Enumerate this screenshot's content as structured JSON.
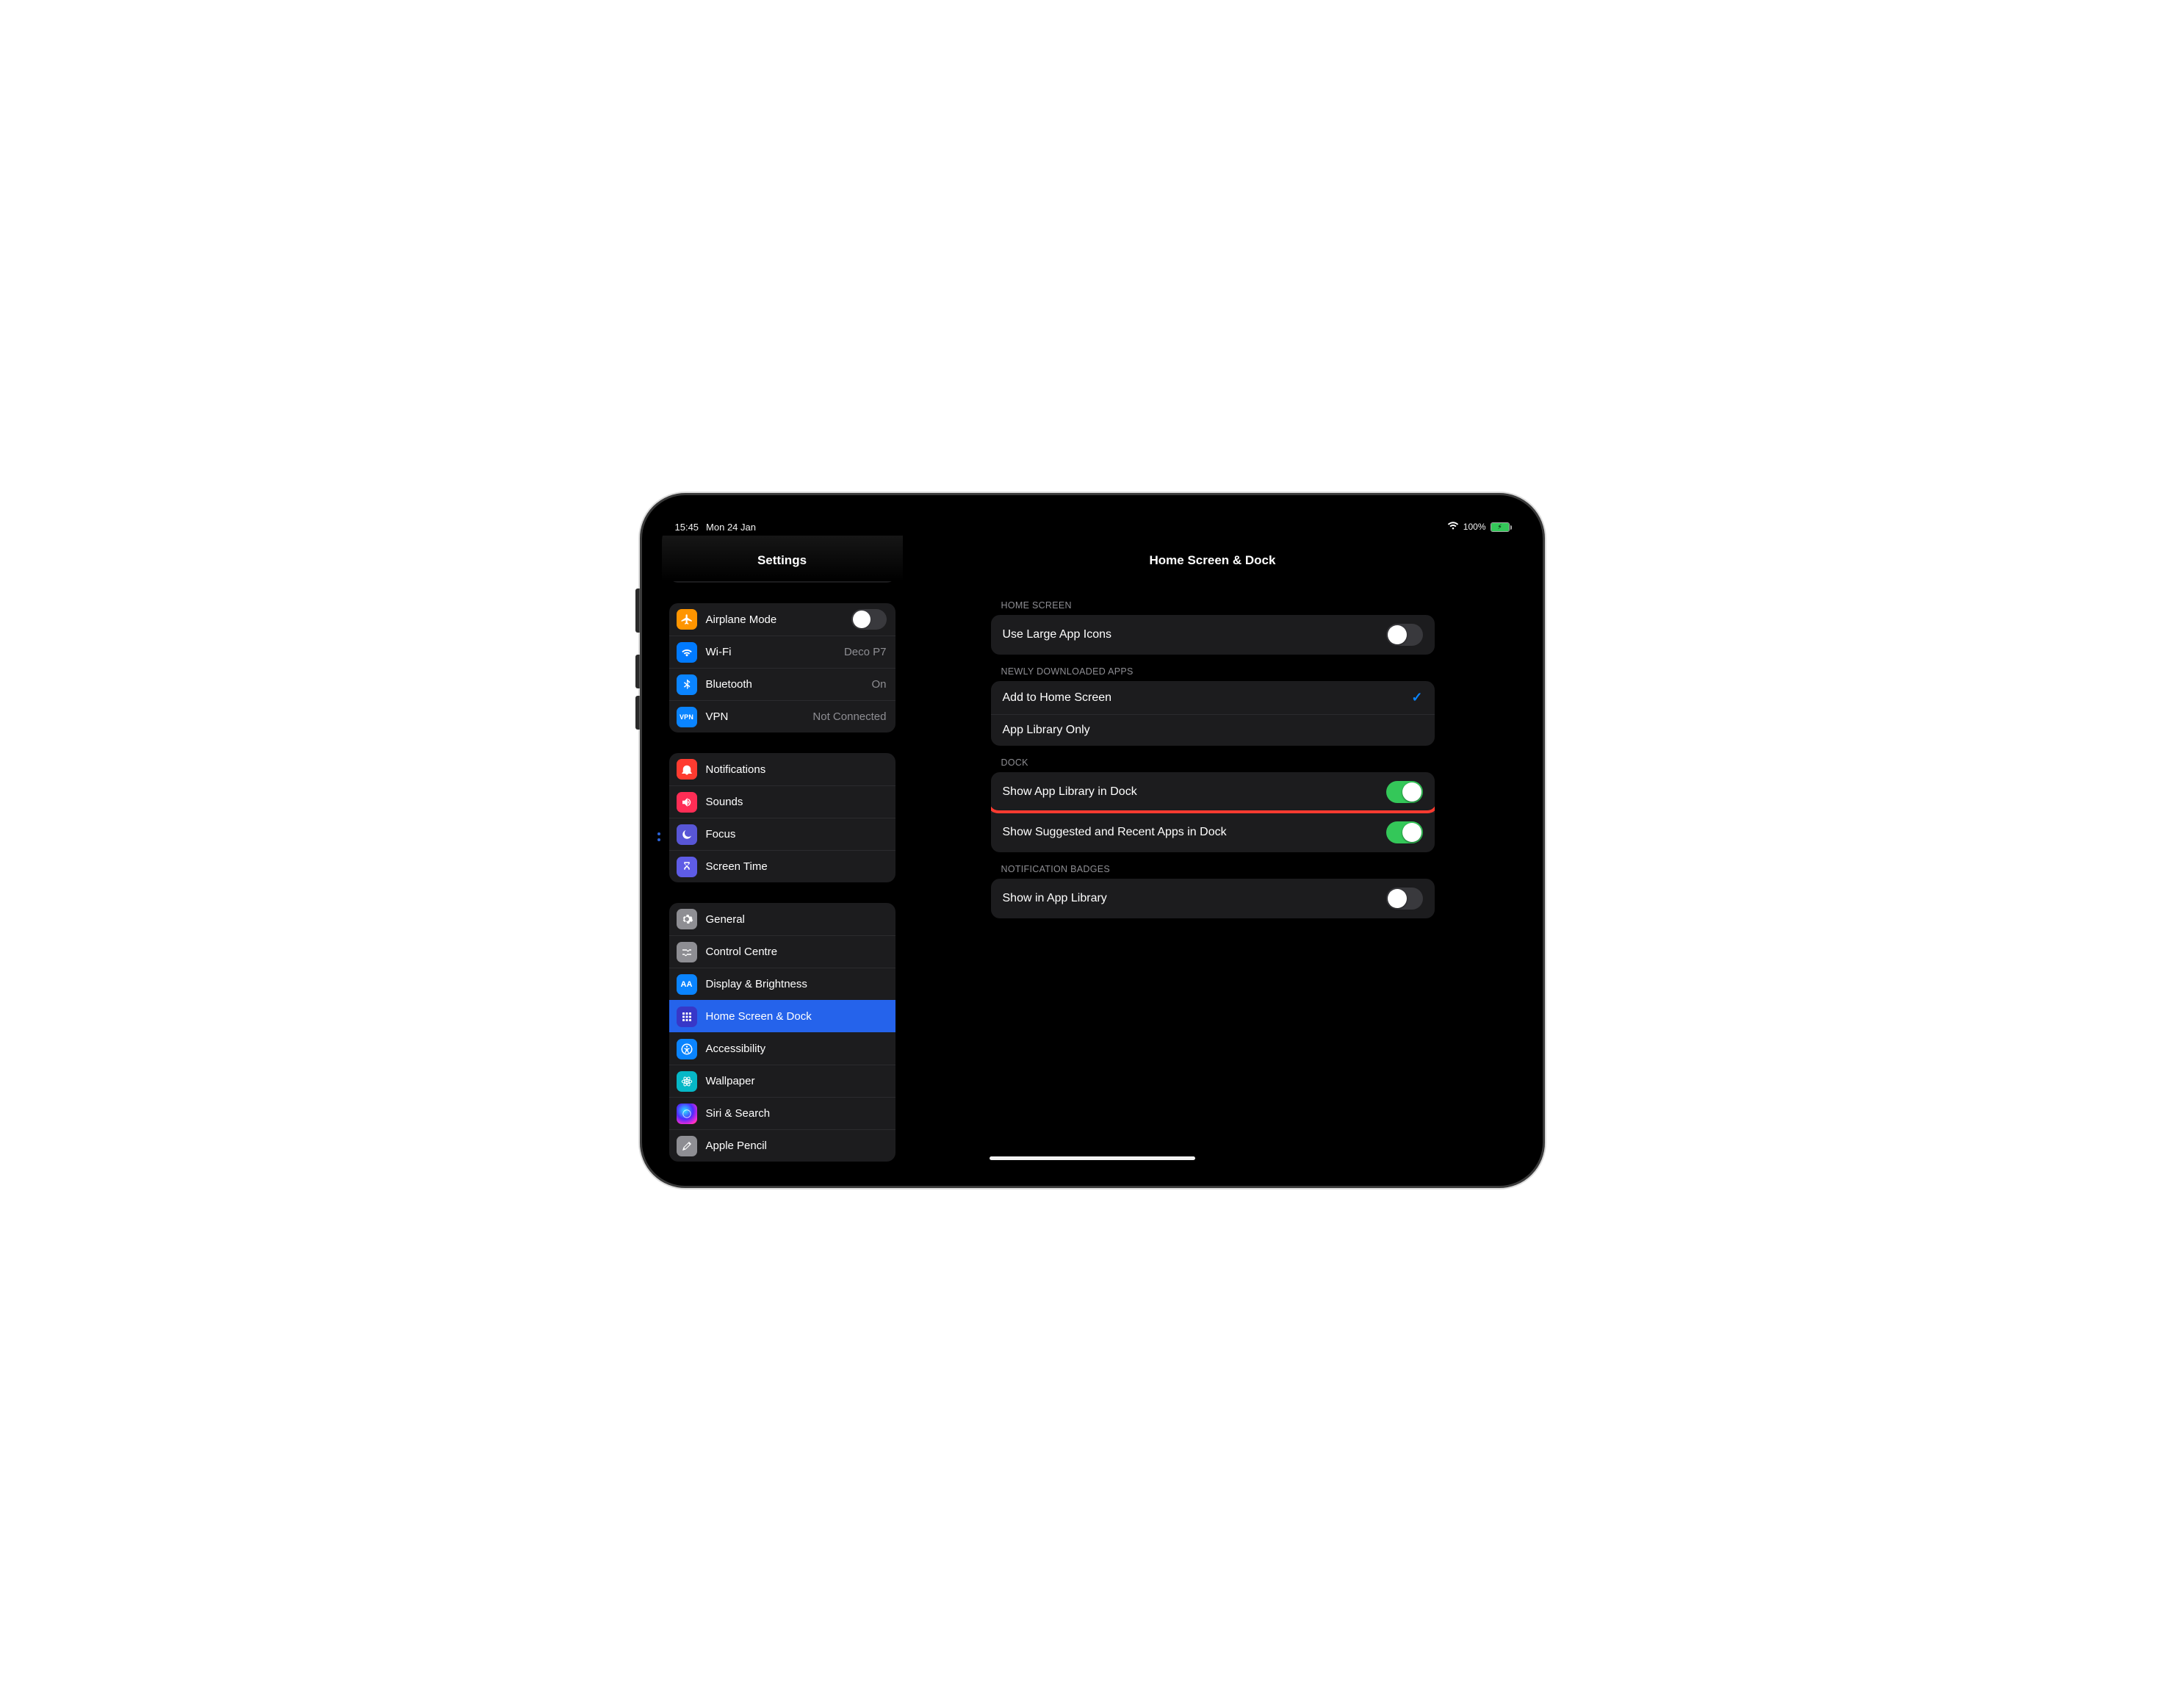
{
  "status": {
    "time": "15:45",
    "date": "Mon 24 Jan",
    "battery_pct": "100%"
  },
  "sidebar": {
    "title": "Settings",
    "group1": [
      {
        "label": "Airplane Mode",
        "toggle": false
      },
      {
        "label": "Wi-Fi",
        "value": "Deco P7"
      },
      {
        "label": "Bluetooth",
        "value": "On"
      },
      {
        "label": "VPN",
        "value": "Not Connected"
      }
    ],
    "group2": [
      {
        "label": "Notifications"
      },
      {
        "label": "Sounds"
      },
      {
        "label": "Focus"
      },
      {
        "label": "Screen Time"
      }
    ],
    "group3": [
      {
        "label": "General"
      },
      {
        "label": "Control Centre"
      },
      {
        "label": "Display & Brightness"
      },
      {
        "label": "Home Screen & Dock",
        "selected": true
      },
      {
        "label": "Accessibility"
      },
      {
        "label": "Wallpaper"
      },
      {
        "label": "Siri & Search"
      },
      {
        "label": "Apple Pencil"
      }
    ]
  },
  "detail": {
    "title": "Home Screen & Dock",
    "sections": {
      "home_screen": {
        "header": "HOME SCREEN",
        "rows": [
          {
            "label": "Use Large App Icons",
            "on": false
          }
        ]
      },
      "newly_downloaded": {
        "header": "NEWLY DOWNLOADED APPS",
        "rows": [
          {
            "label": "Add to Home Screen",
            "checked": true
          },
          {
            "label": "App Library Only",
            "checked": false
          }
        ]
      },
      "dock": {
        "header": "DOCK",
        "rows": [
          {
            "label": "Show App Library in Dock",
            "on": true,
            "highlight": true
          },
          {
            "label": "Show Suggested and Recent Apps in Dock",
            "on": true
          }
        ]
      },
      "badges": {
        "header": "NOTIFICATION BADGES",
        "rows": [
          {
            "label": "Show in App Library",
            "on": false
          }
        ]
      }
    }
  }
}
